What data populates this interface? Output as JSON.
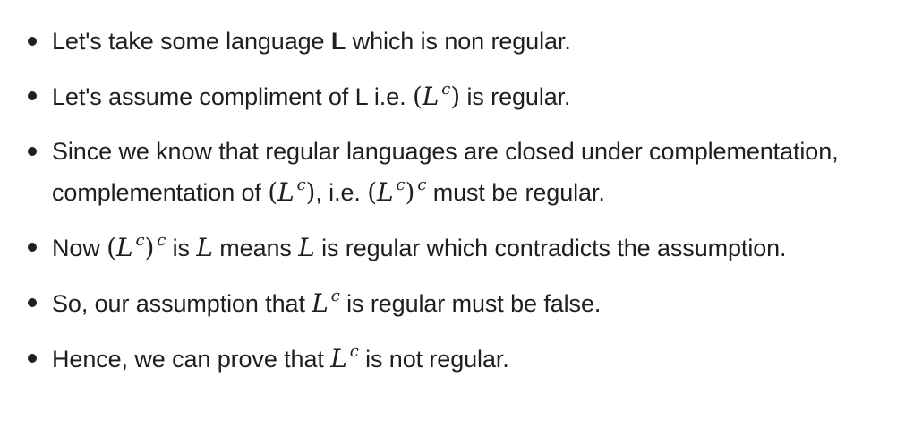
{
  "bullets": [
    {
      "pre": "Let's take some language ",
      "bold": "L",
      "post": " which is non regular."
    },
    {
      "pre": "Let's assume compliment of L i.e. ",
      "math_L": "L",
      "math_c": "c",
      "post": " is regular."
    },
    {
      "pre": "Since we know that regular languages are closed under complementation, complementation of ",
      "math1_L": "L",
      "math1_c": "c",
      "mid": ", i.e. ",
      "math2_L": "L",
      "math2_c": "c",
      "math2_outer_c": "c",
      "post": " must be regular."
    },
    {
      "pre": "Now ",
      "math1_L": "L",
      "math1_c": "c",
      "math1_outer_c": "c",
      "mid1": " is ",
      "math2": "L",
      "mid2": " means ",
      "math3": "L",
      "post": " is regular which contradicts the assumption."
    },
    {
      "pre": "So, our assumption that ",
      "math_L": "L",
      "math_c": "c",
      "post": " is regular must be false."
    },
    {
      "pre": "Hence, we can prove that ",
      "math_L": "L",
      "math_c": "c",
      "post": " is not regular."
    }
  ]
}
